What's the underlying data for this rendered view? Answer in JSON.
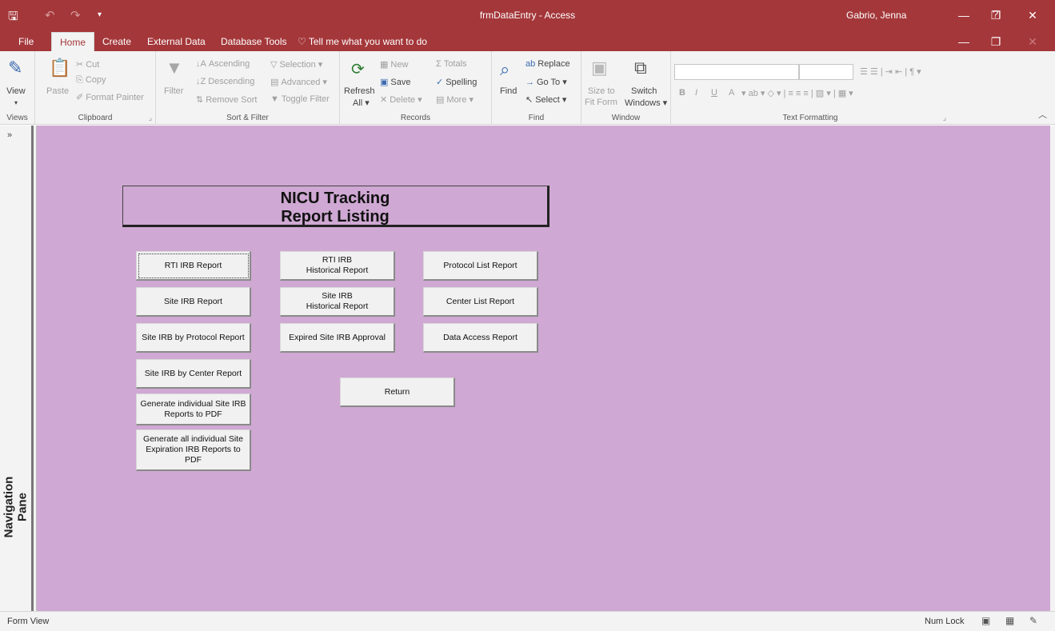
{
  "window": {
    "title": "frmDataEntry - Access",
    "user": "Gabrio, Jenna",
    "help": "?",
    "minimize": "—",
    "restore": "❐",
    "close": "✕"
  },
  "qat": {
    "save_icon": "floppy-icon",
    "undo": "↶",
    "redo": "↷",
    "customize": "▾"
  },
  "tabs": {
    "file": "File",
    "home": "Home",
    "create": "Create",
    "external_data": "External Data",
    "database_tools": "Database Tools",
    "tell_me": "Tell me what you want to do",
    "inner_minimize": "—",
    "inner_restore": "❐",
    "inner_close": "✕"
  },
  "ribbon": {
    "views": {
      "label": "Views",
      "view": "View"
    },
    "clipboard": {
      "label": "Clipboard",
      "paste": "Paste",
      "cut": "Cut",
      "copy": "Copy",
      "format_painter": "Format Painter"
    },
    "sort_filter": {
      "label": "Sort & Filter",
      "filter": "Filter",
      "ascending": "Ascending",
      "descending": "Descending",
      "remove_sort": "Remove Sort",
      "selection": "Selection ▾",
      "advanced": "Advanced ▾",
      "toggle_filter": "Toggle Filter"
    },
    "records": {
      "label": "Records",
      "refresh": "Refresh",
      "all": "All ▾",
      "new": "New",
      "save": "Save",
      "delete": "Delete ▾",
      "totals": "Totals",
      "spelling": "Spelling",
      "more": "More ▾"
    },
    "find": {
      "label": "Find",
      "find": "Find",
      "replace": "Replace",
      "goto": "Go To ▾",
      "select": "Select ▾"
    },
    "window": {
      "label": "Window",
      "size_to": "Size to",
      "fit_form": "Fit Form",
      "switch": "Switch",
      "windows": "Windows ▾"
    },
    "text_formatting": {
      "label": "Text Formatting",
      "bold": "B",
      "italic": "I",
      "underline": "U",
      "font_color": "A"
    }
  },
  "nav_pane": {
    "label": "Navigation Pane",
    "expand": "»"
  },
  "form": {
    "header_line1": "NICU Tracking",
    "header_line2": "Report Listing",
    "buttons": {
      "rti_irb_report": "RTI IRB Report",
      "site_irb_report": "Site IRB Report",
      "site_irb_by_protocol": "Site IRB by Protocol Report",
      "site_irb_by_center": "Site IRB by Center Report",
      "generate_individual_pdf": "Generate individual Site IRB\nReports to PDF",
      "generate_all_expiration_pdf": "Generate all individual Site\nExpiration IRB  Reports to\nPDF",
      "rti_irb_historical": "RTI IRB\nHistorical Report",
      "site_irb_historical": "Site IRB\nHistorical Report",
      "expired_site_irb": "Expired Site IRB Approval",
      "protocol_list": "Protocol List Report",
      "center_list": "Center List Report",
      "data_access": "Data Access Report",
      "return": "Return"
    }
  },
  "status": {
    "left": "Form View",
    "num_lock": "Num Lock"
  }
}
